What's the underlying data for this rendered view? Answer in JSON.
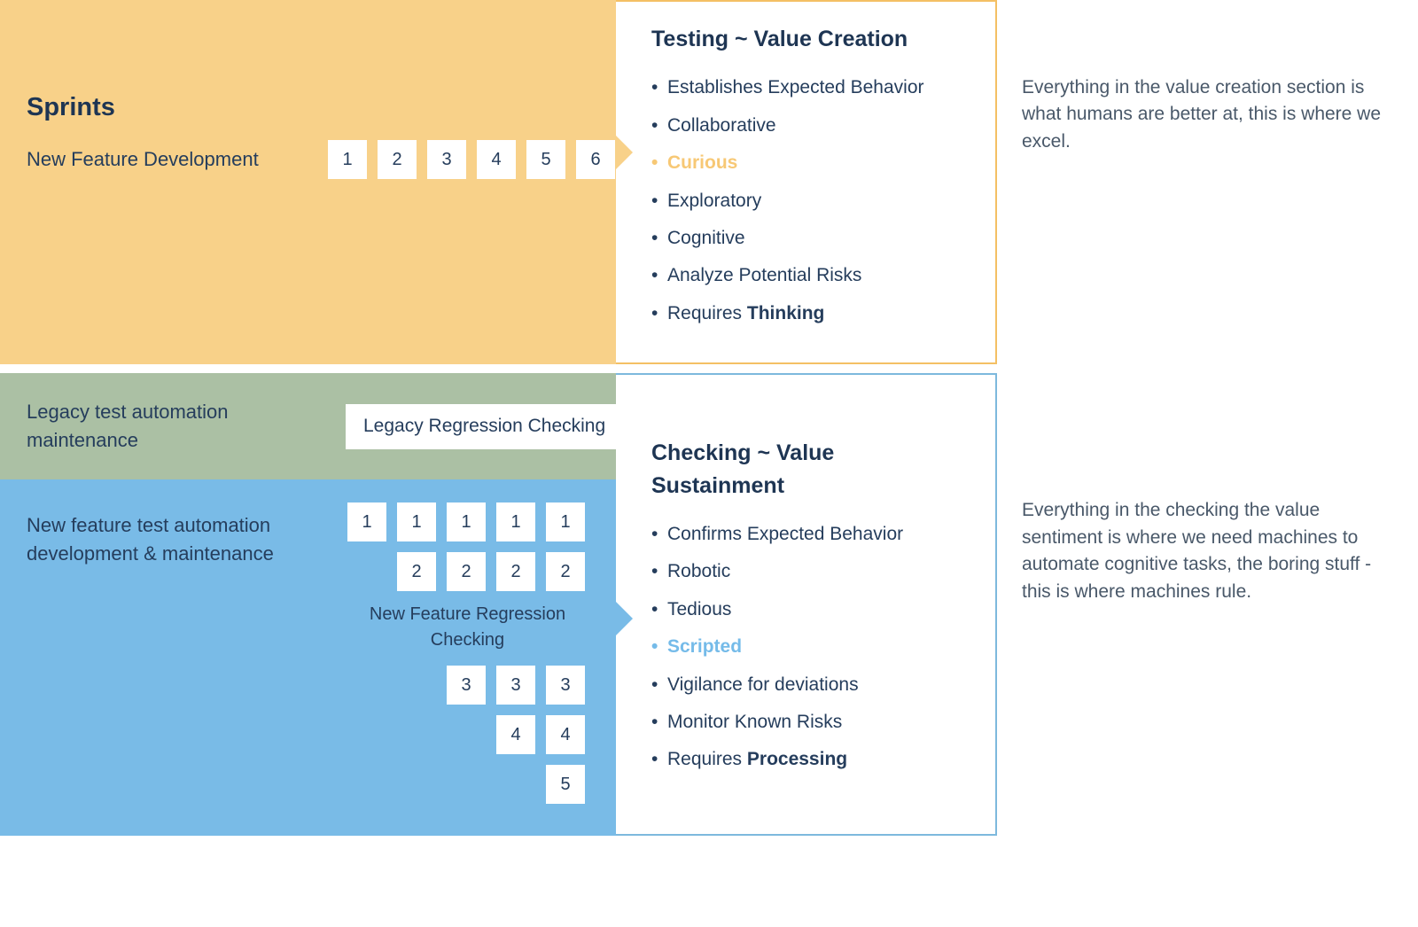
{
  "sprints": {
    "title": "Sprints",
    "subtitle": "New Feature Development",
    "boxes": [
      "1",
      "2",
      "3",
      "4",
      "5",
      "6"
    ]
  },
  "legacy": {
    "label": "Legacy test automation maintenance",
    "box": "Legacy Regression Checking"
  },
  "newfeat": {
    "label": "New feature test automation development & maintenance",
    "caption": "New Feature Regression Checking",
    "rows": [
      [
        "1",
        "1",
        "1",
        "1",
        "1"
      ],
      [
        "2",
        "2",
        "2",
        "2"
      ],
      [
        "3",
        "3",
        "3"
      ],
      [
        "4",
        "4"
      ],
      [
        "5"
      ]
    ]
  },
  "testing": {
    "title": "Testing ~ Value Creation",
    "items": [
      {
        "t": "Establishes Expected Behavior"
      },
      {
        "t": "Collaborative"
      },
      {
        "t": "Curious",
        "hl": "yellow"
      },
      {
        "t": "Exploratory"
      },
      {
        "t": "Cognitive"
      },
      {
        "t": "Analyze Potential Risks"
      },
      {
        "t": "Requires ",
        "b": "Thinking"
      }
    ],
    "side": "Everything in the value creation section is what humans are better at, this is where we excel."
  },
  "checking": {
    "title": "Checking ~ Value Sustainment",
    "items": [
      {
        "t": "Confirms Expected Behavior"
      },
      {
        "t": "Robotic"
      },
      {
        "t": "Tedious"
      },
      {
        "t": "Scripted",
        "hl": "blue"
      },
      {
        "t": "Vigilance for deviations"
      },
      {
        "t": "Monitor Known Risks"
      },
      {
        "t": "Requires ",
        "b": "Processing"
      }
    ],
    "side": "Everything in the checking the value sentiment is where we need machines to automate cognitive tasks, the boring stuff - this is where machines rule."
  }
}
